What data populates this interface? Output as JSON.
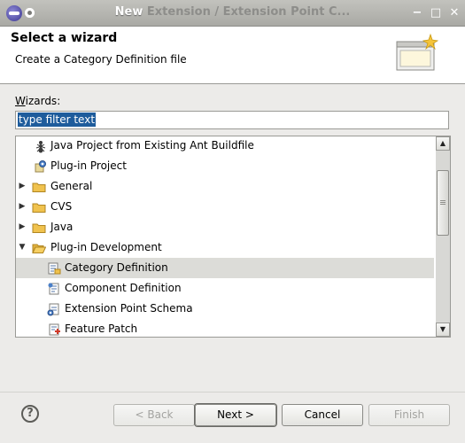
{
  "window": {
    "title": "New",
    "title_ghost": "Extension / Extension Point C...",
    "minimize_glyph": "−",
    "maximize_glyph": "□",
    "close_glyph": "✕"
  },
  "banner": {
    "title": "Select a wizard",
    "description": "Create a Category Definition file"
  },
  "wizards_label_mnemonic": "W",
  "wizards_label_rest": "izards:",
  "filter": {
    "value": "type filter text"
  },
  "tree": {
    "rows": [
      {
        "label": "Java Project from Existing Ant Buildfile",
        "icon": "ant-icon",
        "expander": ""
      },
      {
        "label": "Plug-in Project",
        "icon": "plugin-project-icon",
        "expander": ""
      },
      {
        "label": "General",
        "icon": "folder-icon",
        "expander": "▶"
      },
      {
        "label": "CVS",
        "icon": "folder-icon",
        "expander": "▶"
      },
      {
        "label": "Java",
        "icon": "folder-icon",
        "expander": "▶"
      },
      {
        "label": "Plug-in Development",
        "icon": "folder-open-icon",
        "expander": "▼"
      },
      {
        "label": "Category Definition",
        "icon": "category-definition-icon",
        "expander": "",
        "selected": true
      },
      {
        "label": "Component Definition",
        "icon": "component-definition-icon",
        "expander": ""
      },
      {
        "label": "Extension Point Schema",
        "icon": "extension-point-schema-icon",
        "expander": ""
      },
      {
        "label": "Feature Patch",
        "icon": "feature-patch-icon",
        "expander": ""
      }
    ]
  },
  "buttons": {
    "help_glyph": "?",
    "back": "< Back",
    "next": "Next >",
    "cancel": "Cancel",
    "finish": "Finish"
  },
  "scroll_glyphs": {
    "up": "▲",
    "down": "▼"
  }
}
